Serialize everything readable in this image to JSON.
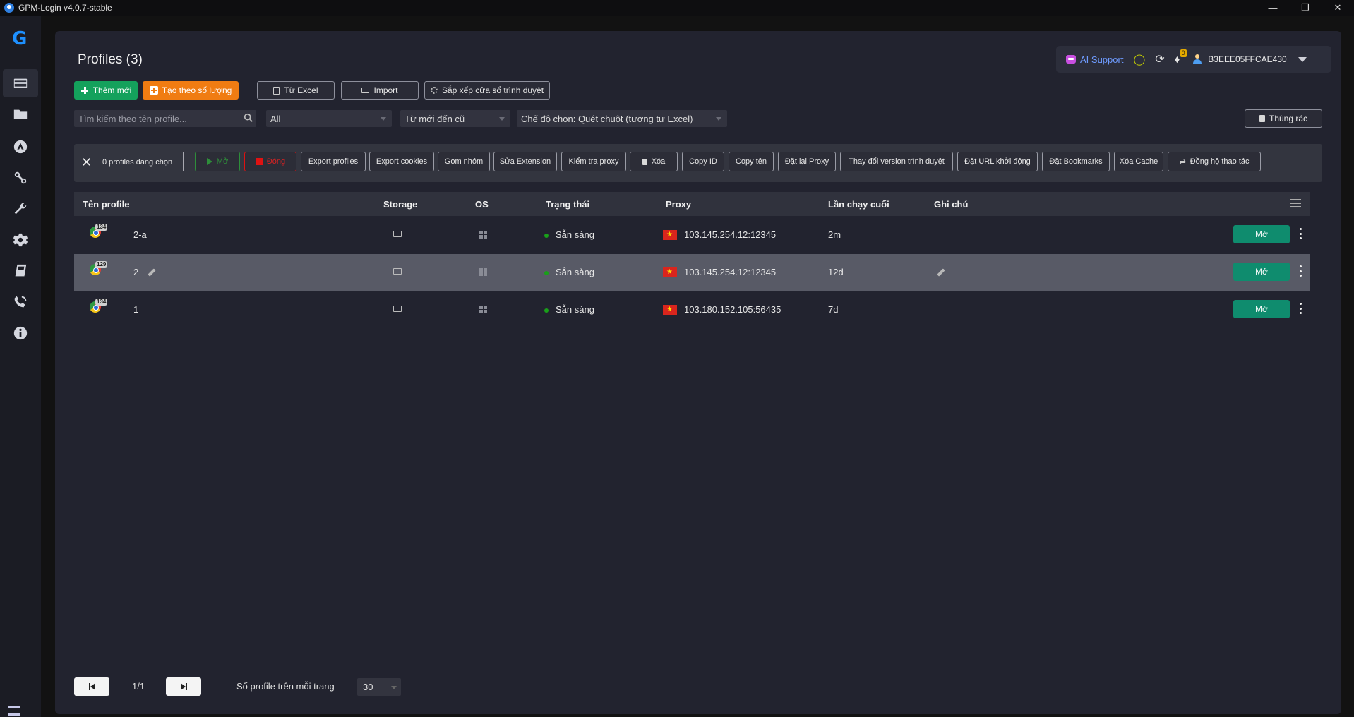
{
  "window": {
    "title": "GPM-Login v4.0.7-stable"
  },
  "header": {
    "title": "Profiles (3)",
    "ai_support": "AI Support",
    "notification_count": "0",
    "user_id": "B3EEE05FFCAE430"
  },
  "actions": {
    "add_new": "Thêm mới",
    "bulk_create": "Tạo theo số lượng",
    "from_excel": "Từ Excel",
    "import": "Import",
    "arrange_windows": "Sắp xếp cửa sổ trình duyệt",
    "trash": "Thùng rác"
  },
  "filters": {
    "search_placeholder": "Tìm kiếm theo tên profile...",
    "group": "All",
    "sort": "Từ mới đến cũ",
    "select_mode": "Chế độ chọn: Quét chuột (tương tự Excel)"
  },
  "bulk": {
    "selected_text": "0 profiles đang chọn",
    "open": "Mở",
    "close": "Đóng",
    "buttons": [
      "Export profiles",
      "Export cookies",
      "Gom nhóm",
      "Sửa Extension",
      "Kiểm tra proxy",
      "Xóa",
      "Copy ID",
      "Copy tên",
      "Đặt lại Proxy",
      "Thay đổi version trình duyệt",
      "Đặt URL khởi động",
      "Đặt Bookmarks",
      "Xóa Cache",
      "Đồng hộ thao tác"
    ]
  },
  "table": {
    "columns": [
      "Tên profile",
      "Storage",
      "OS",
      "Trạng thái",
      "Proxy",
      "Lần chạy cuối",
      "Ghi chú"
    ],
    "rows": [
      {
        "version": "134",
        "name": "2-a",
        "status": "Sẵn sàng",
        "proxy": "103.145.254.12:12345",
        "last_run": "2m",
        "open": "Mở"
      },
      {
        "version": "129",
        "name": "2",
        "status": "Sẵn sàng",
        "proxy": "103.145.254.12:12345",
        "last_run": "12d",
        "open": "Mở"
      },
      {
        "version": "134",
        "name": "1",
        "status": "Sẵn sàng",
        "proxy": "103.180.152.105:56435",
        "last_run": "7d",
        "open": "Mở"
      }
    ]
  },
  "pagination": {
    "page": "1/1",
    "per_page_label": "Số profile trên mỗi trang",
    "per_page": "30"
  },
  "icons": [
    "gpm-logo-icon",
    "profiles-icon",
    "folder-icon",
    "store-icon",
    "proxy-icon",
    "tools-icon",
    "settings-icon",
    "docs-icon",
    "support-icon",
    "info-icon"
  ],
  "colors": {
    "green": "#14a15c",
    "orange": "#f07c12",
    "open_button": "#0f8c6e",
    "link": "#6e9bff"
  }
}
